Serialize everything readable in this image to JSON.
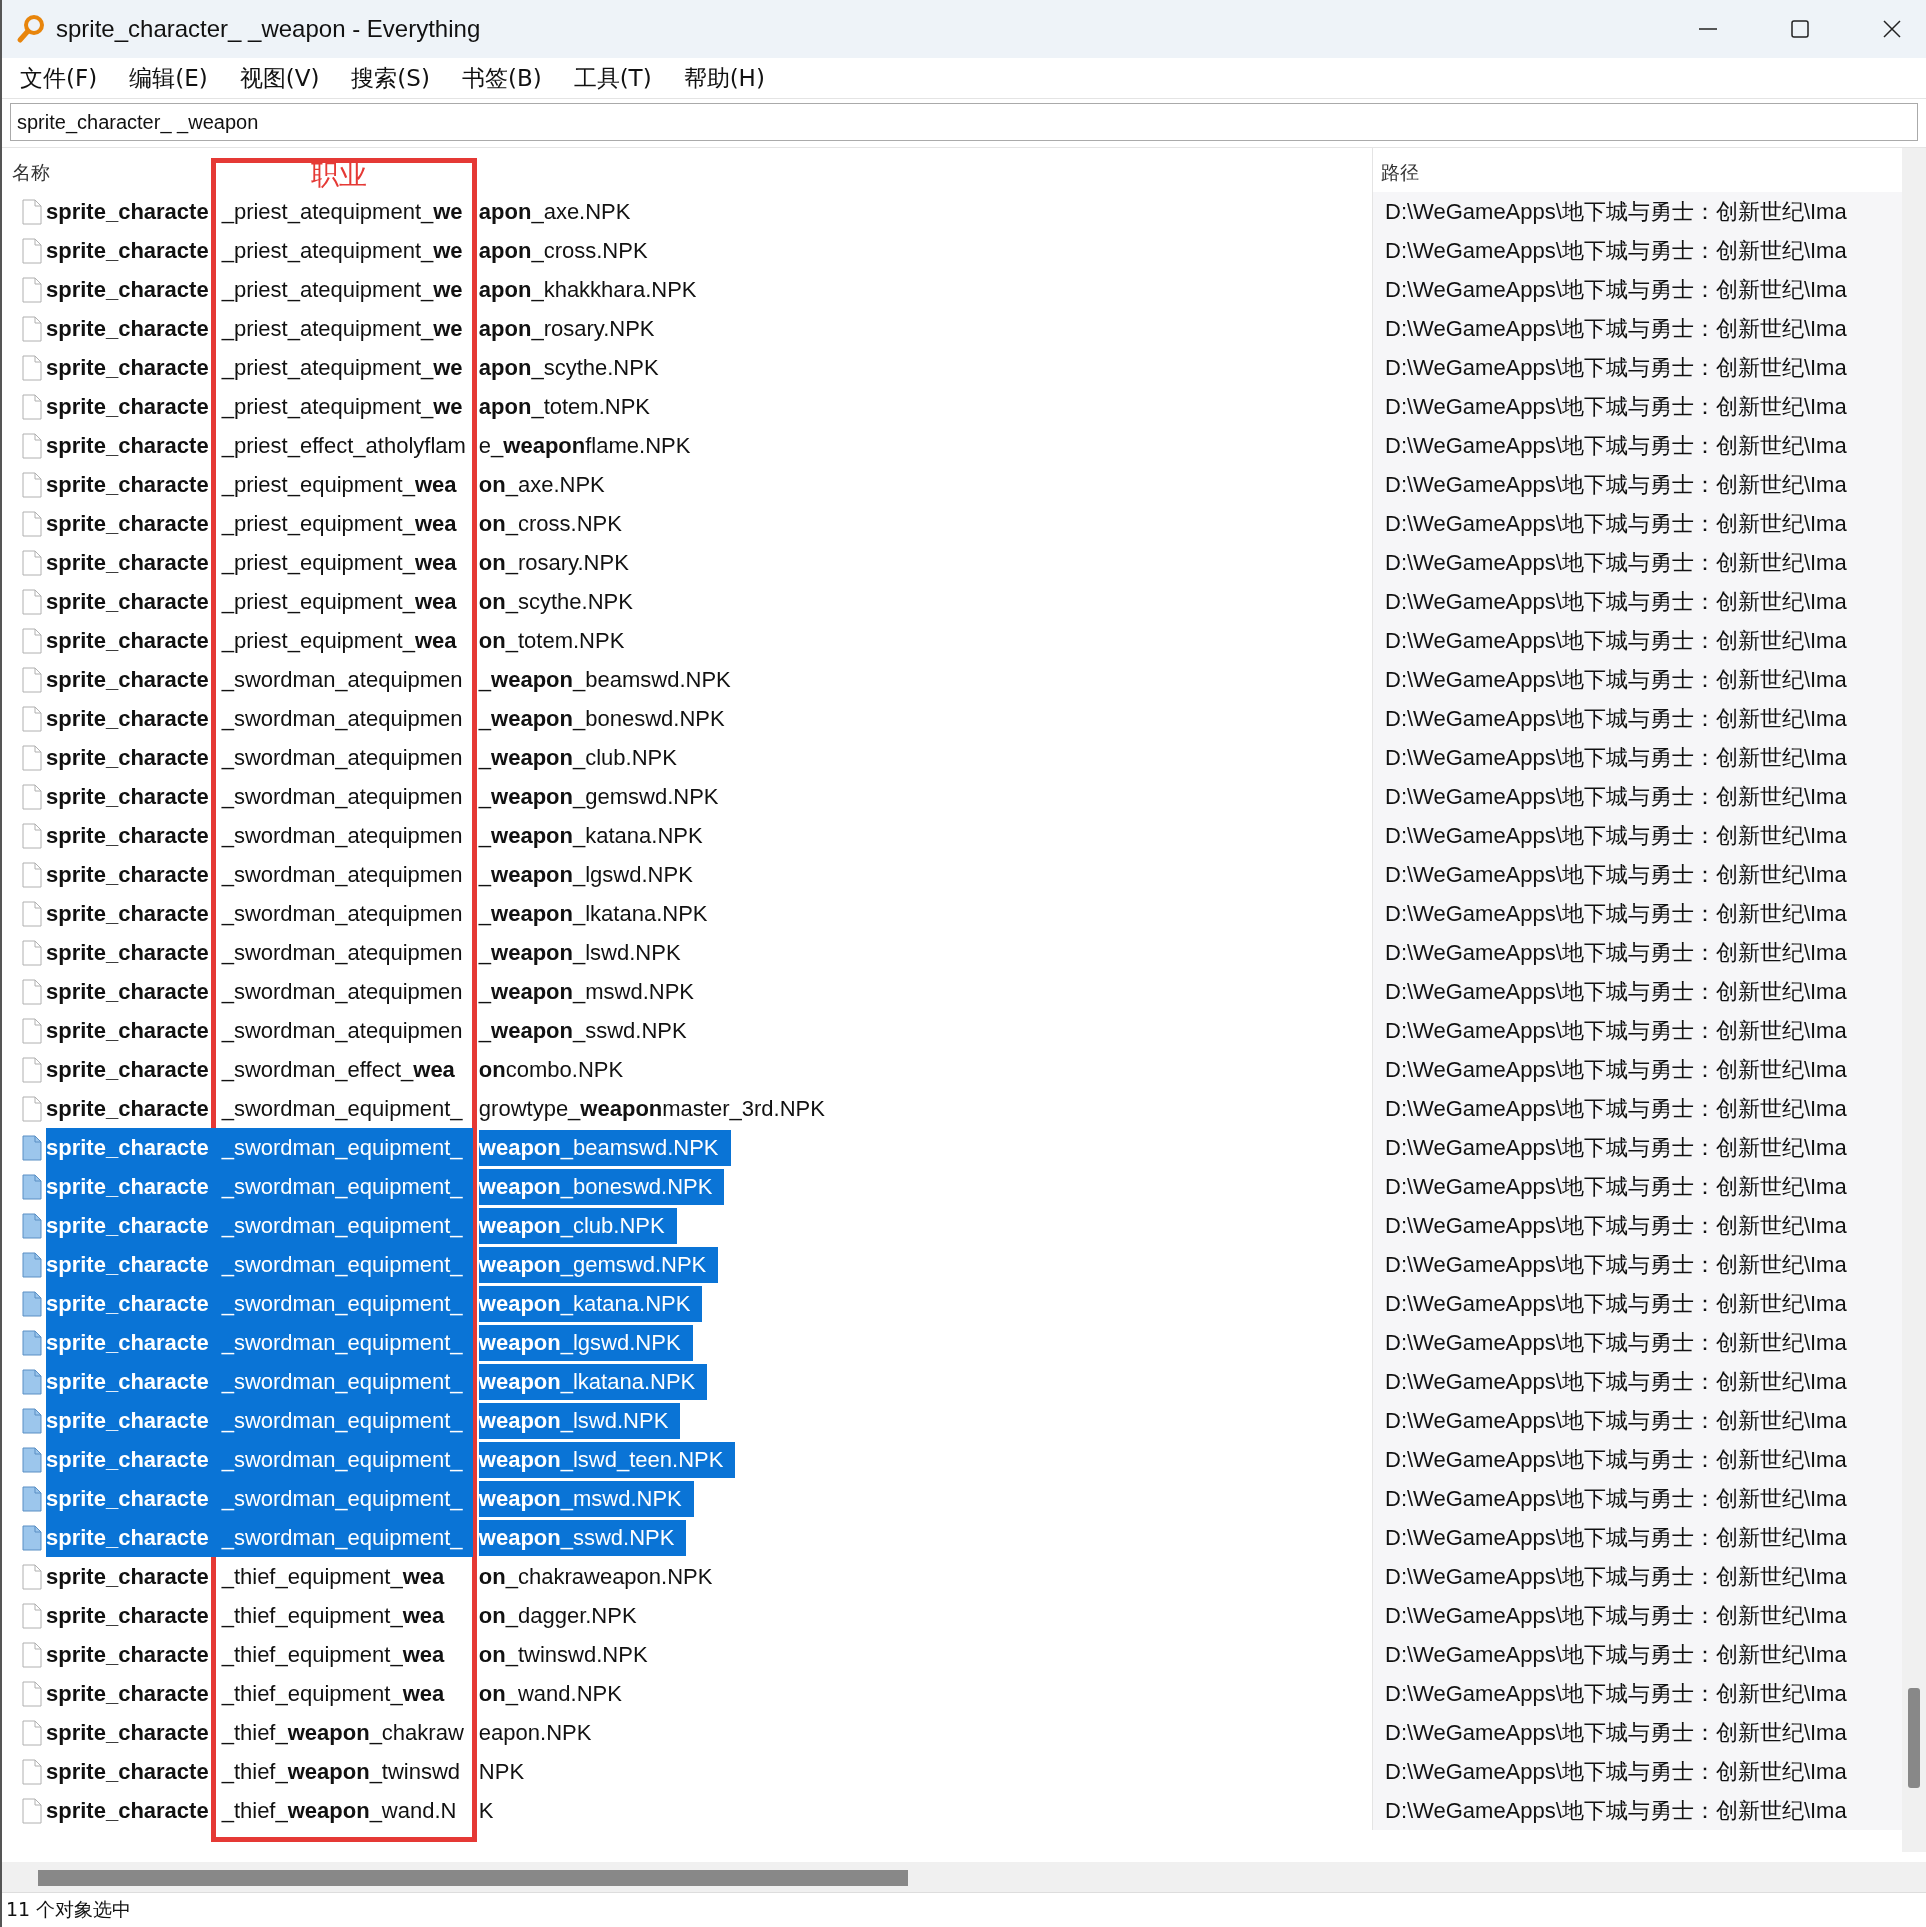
{
  "window": {
    "title": "sprite_character_ _weapon - Everything"
  },
  "menu": [
    "文件(F)",
    "编辑(E)",
    "视图(V)",
    "搜索(S)",
    "书签(B)",
    "工具(T)",
    "帮助(H)"
  ],
  "search": {
    "value": "sprite_character_ _weapon"
  },
  "columns": [
    "名称",
    "路径"
  ],
  "annotation": {
    "label": "职业"
  },
  "rows": [
    {
      "name": [
        "**sprite_characte**",
        "_priest_atequipment_**we**",
        "**apon**_axe.NPK"
      ],
      "path": "D:\\WeGameApps\\地下城与勇士：创新世纪\\Ima",
      "selected": false
    },
    {
      "name": [
        "**sprite_characte**",
        "_priest_atequipment_**we**",
        "**apon**_cross.NPK"
      ],
      "path": "D:\\WeGameApps\\地下城与勇士：创新世纪\\Ima",
      "selected": false
    },
    {
      "name": [
        "**sprite_characte**",
        "_priest_atequipment_**we**",
        "**apon**_khakkhara.NPK"
      ],
      "path": "D:\\WeGameApps\\地下城与勇士：创新世纪\\Ima",
      "selected": false
    },
    {
      "name": [
        "**sprite_characte**",
        "_priest_atequipment_**we**",
        "**apon**_rosary.NPK"
      ],
      "path": "D:\\WeGameApps\\地下城与勇士：创新世纪\\Ima",
      "selected": false
    },
    {
      "name": [
        "**sprite_characte**",
        "_priest_atequipment_**we**",
        "**apon**_scythe.NPK"
      ],
      "path": "D:\\WeGameApps\\地下城与勇士：创新世纪\\Ima",
      "selected": false
    },
    {
      "name": [
        "**sprite_characte**",
        "_priest_atequipment_**we**",
        "**apon**_totem.NPK"
      ],
      "path": "D:\\WeGameApps\\地下城与勇士：创新世纪\\Ima",
      "selected": false
    },
    {
      "name": [
        "**sprite_characte**",
        "_priest_effect_atholyflam",
        "e_**weapon**flame.NPK"
      ],
      "path": "D:\\WeGameApps\\地下城与勇士：创新世纪\\Ima",
      "selected": false
    },
    {
      "name": [
        "**sprite_characte**",
        "_priest_equipment_**wea**",
        "**on**_axe.NPK"
      ],
      "path": "D:\\WeGameApps\\地下城与勇士：创新世纪\\Ima",
      "selected": false
    },
    {
      "name": [
        "**sprite_characte**",
        "_priest_equipment_**wea**",
        "**on**_cross.NPK"
      ],
      "path": "D:\\WeGameApps\\地下城与勇士：创新世纪\\Ima",
      "selected": false
    },
    {
      "name": [
        "**sprite_characte**",
        "_priest_equipment_**wea**",
        "**on**_rosary.NPK"
      ],
      "path": "D:\\WeGameApps\\地下城与勇士：创新世纪\\Ima",
      "selected": false
    },
    {
      "name": [
        "**sprite_characte**",
        "_priest_equipment_**wea**",
        "**on**_scythe.NPK"
      ],
      "path": "D:\\WeGameApps\\地下城与勇士：创新世纪\\Ima",
      "selected": false
    },
    {
      "name": [
        "**sprite_characte**",
        "_priest_equipment_**wea**",
        "**on**_totem.NPK"
      ],
      "path": "D:\\WeGameApps\\地下城与勇士：创新世纪\\Ima",
      "selected": false
    },
    {
      "name": [
        "**sprite_characte**",
        "_swordman_atequipmen",
        "_**weapon**_beamswd.NPK"
      ],
      "path": "D:\\WeGameApps\\地下城与勇士：创新世纪\\Ima",
      "selected": false
    },
    {
      "name": [
        "**sprite_characte**",
        "_swordman_atequipmen",
        "_**weapon**_boneswd.NPK"
      ],
      "path": "D:\\WeGameApps\\地下城与勇士：创新世纪\\Ima",
      "selected": false
    },
    {
      "name": [
        "**sprite_characte**",
        "_swordman_atequipmen",
        "_**weapon**_club.NPK"
      ],
      "path": "D:\\WeGameApps\\地下城与勇士：创新世纪\\Ima",
      "selected": false
    },
    {
      "name": [
        "**sprite_characte**",
        "_swordman_atequipmen",
        "_**weapon**_gemswd.NPK"
      ],
      "path": "D:\\WeGameApps\\地下城与勇士：创新世纪\\Ima",
      "selected": false
    },
    {
      "name": [
        "**sprite_characte**",
        "_swordman_atequipmen",
        "_**weapon**_katana.NPK"
      ],
      "path": "D:\\WeGameApps\\地下城与勇士：创新世纪\\Ima",
      "selected": false
    },
    {
      "name": [
        "**sprite_characte**",
        "_swordman_atequipmen",
        "_**weapon**_lgswd.NPK"
      ],
      "path": "D:\\WeGameApps\\地下城与勇士：创新世纪\\Ima",
      "selected": false
    },
    {
      "name": [
        "**sprite_characte**",
        "_swordman_atequipmen",
        "_**weapon**_lkatana.NPK"
      ],
      "path": "D:\\WeGameApps\\地下城与勇士：创新世纪\\Ima",
      "selected": false
    },
    {
      "name": [
        "**sprite_characte**",
        "_swordman_atequipmen",
        "_**weapon**_lswd.NPK"
      ],
      "path": "D:\\WeGameApps\\地下城与勇士：创新世纪\\Ima",
      "selected": false
    },
    {
      "name": [
        "**sprite_characte**",
        "_swordman_atequipmen",
        "_**weapon**_mswd.NPK"
      ],
      "path": "D:\\WeGameApps\\地下城与勇士：创新世纪\\Ima",
      "selected": false
    },
    {
      "name": [
        "**sprite_characte**",
        "_swordman_atequipmen",
        "_**weapon**_sswd.NPK"
      ],
      "path": "D:\\WeGameApps\\地下城与勇士：创新世纪\\Ima",
      "selected": false
    },
    {
      "name": [
        "**sprite_characte**",
        "_swordman_effect_**wea**",
        "**on**combo.NPK"
      ],
      "path": "D:\\WeGameApps\\地下城与勇士：创新世纪\\Ima",
      "selected": false
    },
    {
      "name": [
        "**sprite_characte**",
        "_swordman_equipment_",
        "growtype_**weapon**master_3rd.NPK"
      ],
      "path": "D:\\WeGameApps\\地下城与勇士：创新世纪\\Ima",
      "selected": false
    },
    {
      "name": [
        "**sprite_characte**",
        "_swordman_equipment_",
        "**weapon**_beamswd.NPK"
      ],
      "path": "D:\\WeGameApps\\地下城与勇士：创新世纪\\Ima",
      "selected": true
    },
    {
      "name": [
        "**sprite_characte**",
        "_swordman_equipment_",
        "**weapon**_boneswd.NPK"
      ],
      "path": "D:\\WeGameApps\\地下城与勇士：创新世纪\\Ima",
      "selected": true
    },
    {
      "name": [
        "**sprite_characte**",
        "_swordman_equipment_",
        "**weapon**_club.NPK"
      ],
      "path": "D:\\WeGameApps\\地下城与勇士：创新世纪\\Ima",
      "selected": true
    },
    {
      "name": [
        "**sprite_characte**",
        "_swordman_equipment_",
        "**weapon**_gemswd.NPK"
      ],
      "path": "D:\\WeGameApps\\地下城与勇士：创新世纪\\Ima",
      "selected": true
    },
    {
      "name": [
        "**sprite_characte**",
        "_swordman_equipment_",
        "**weapon**_katana.NPK"
      ],
      "path": "D:\\WeGameApps\\地下城与勇士：创新世纪\\Ima",
      "selected": true
    },
    {
      "name": [
        "**sprite_characte**",
        "_swordman_equipment_",
        "**weapon**_lgswd.NPK"
      ],
      "path": "D:\\WeGameApps\\地下城与勇士：创新世纪\\Ima",
      "selected": true
    },
    {
      "name": [
        "**sprite_characte**",
        "_swordman_equipment_",
        "**weapon**_lkatana.NPK"
      ],
      "path": "D:\\WeGameApps\\地下城与勇士：创新世纪\\Ima",
      "selected": true
    },
    {
      "name": [
        "**sprite_characte**",
        "_swordman_equipment_",
        "**weapon**_lswd.NPK"
      ],
      "path": "D:\\WeGameApps\\地下城与勇士：创新世纪\\Ima",
      "selected": true
    },
    {
      "name": [
        "**sprite_characte**",
        "_swordman_equipment_",
        "**weapon**_lswd_teen.NPK"
      ],
      "path": "D:\\WeGameApps\\地下城与勇士：创新世纪\\Ima",
      "selected": true
    },
    {
      "name": [
        "**sprite_characte**",
        "_swordman_equipment_",
        "**weapon**_mswd.NPK"
      ],
      "path": "D:\\WeGameApps\\地下城与勇士：创新世纪\\Ima",
      "selected": true
    },
    {
      "name": [
        "**sprite_characte**",
        "_swordman_equipment_",
        "**weapon**_sswd.NPK"
      ],
      "path": "D:\\WeGameApps\\地下城与勇士：创新世纪\\Ima",
      "selected": true
    },
    {
      "name": [
        "**sprite_characte**",
        "_thief_equipment_**wea**",
        "**on**_chakraweapon.NPK"
      ],
      "path": "D:\\WeGameApps\\地下城与勇士：创新世纪\\Ima",
      "selected": false
    },
    {
      "name": [
        "**sprite_characte**",
        "_thief_equipment_**wea**",
        "**on**_dagger.NPK"
      ],
      "path": "D:\\WeGameApps\\地下城与勇士：创新世纪\\Ima",
      "selected": false
    },
    {
      "name": [
        "**sprite_characte**",
        "_thief_equipment_**wea**",
        "**on**_twinswd.NPK"
      ],
      "path": "D:\\WeGameApps\\地下城与勇士：创新世纪\\Ima",
      "selected": false
    },
    {
      "name": [
        "**sprite_characte**",
        "_thief_equipment_**wea**",
        "**on**_wand.NPK"
      ],
      "path": "D:\\WeGameApps\\地下城与勇士：创新世纪\\Ima",
      "selected": false
    },
    {
      "name": [
        "**sprite_characte**",
        "_thief_**weapon**_chakraw",
        "eapon.NPK"
      ],
      "path": "D:\\WeGameApps\\地下城与勇士：创新世纪\\Ima",
      "selected": false
    },
    {
      "name": [
        "**sprite_characte**",
        "_thief_**weapon**_twinswd",
        "NPK"
      ],
      "path": "D:\\WeGameApps\\地下城与勇士：创新世纪\\Ima",
      "selected": false
    },
    {
      "name": [
        "**sprite_characte**",
        "_thief_**weapon**_wand.N",
        "K"
      ],
      "path": "D:\\WeGameApps\\地下城与勇士：创新世纪\\Ima",
      "selected": false
    }
  ],
  "status_bar": "11 个对象选中"
}
